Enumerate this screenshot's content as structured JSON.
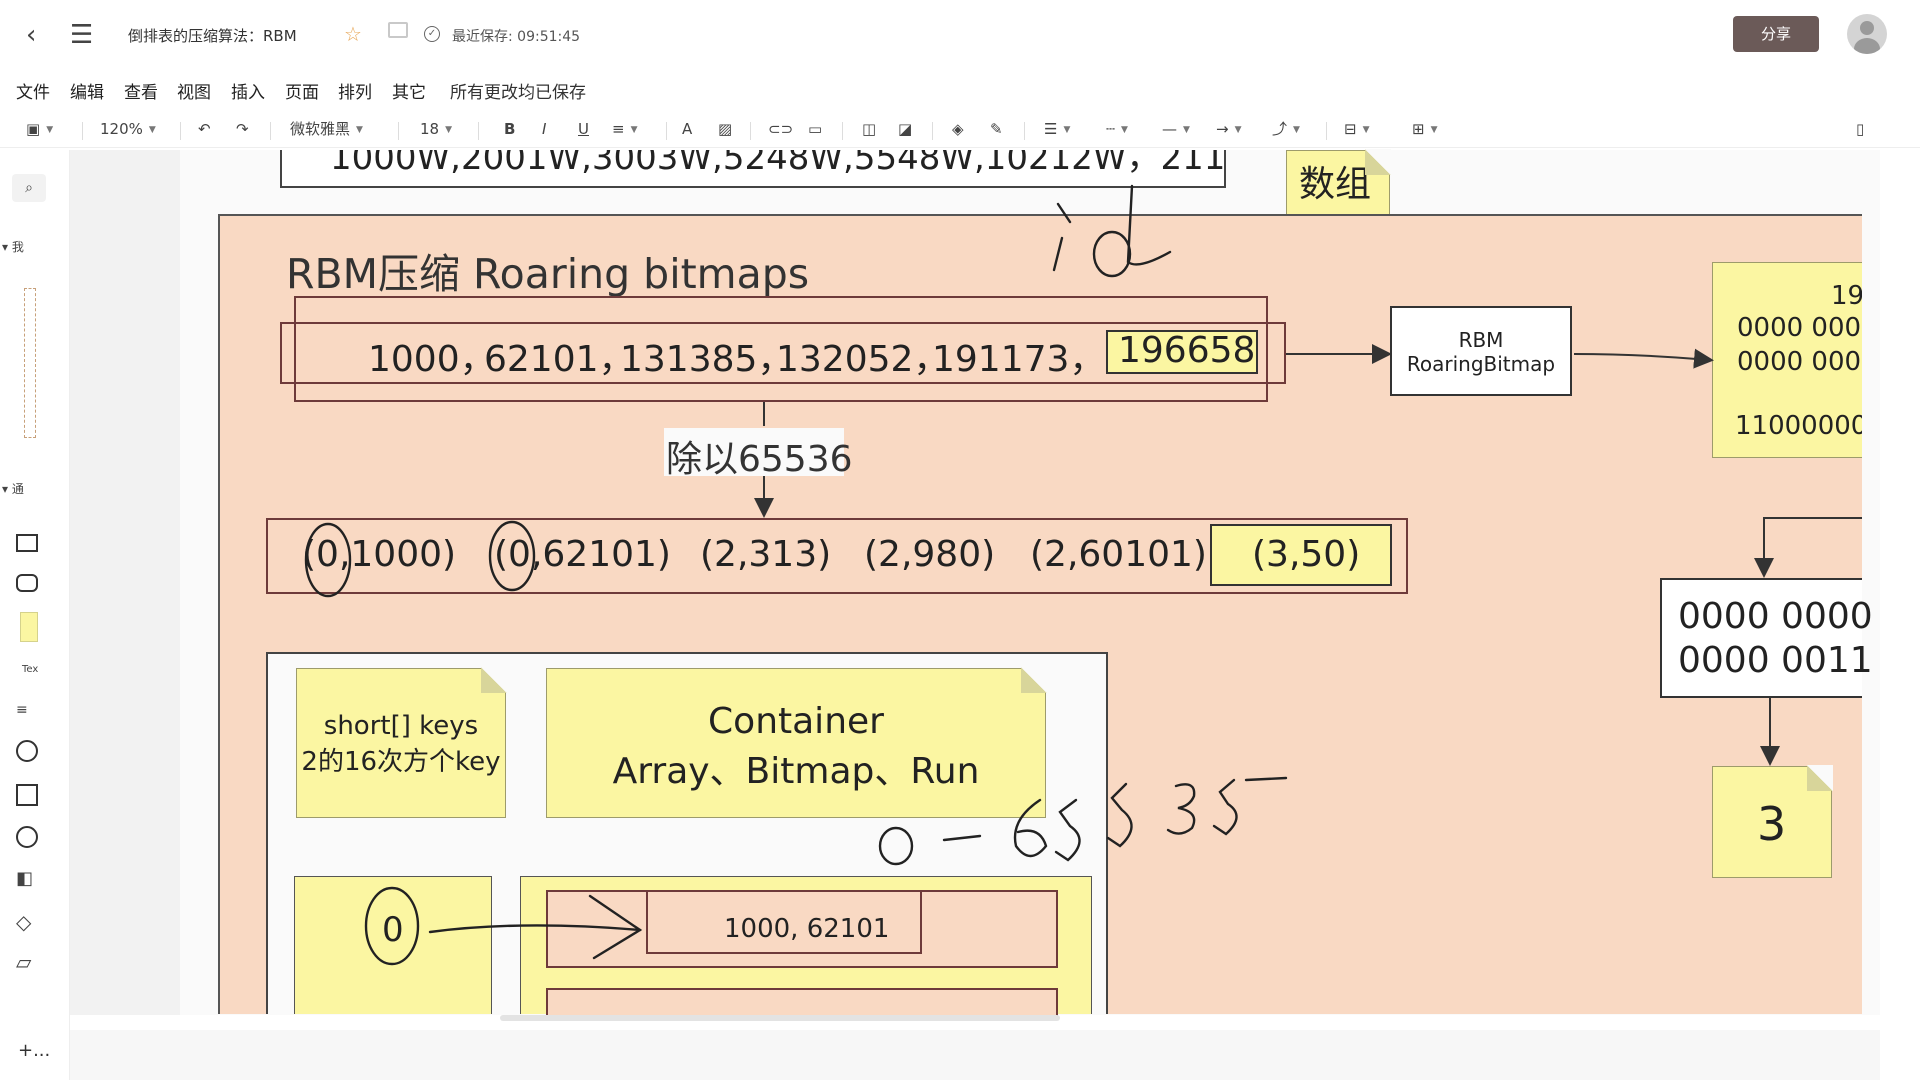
{
  "titlebar": {
    "doc_title": "倒排表的压缩算法：RBM",
    "save_time": "最近保存: 09:51:45",
    "share_label": "分享"
  },
  "menu": [
    "文件",
    "编辑",
    "查看",
    "视图",
    "插入",
    "页面",
    "排列",
    "其它",
    "所有更改均已保存"
  ],
  "toolbar": {
    "zoom": "120%",
    "font": "微软雅黑",
    "font_size": "18",
    "bold": "B",
    "italic": "I",
    "underline": "U",
    "font_color": "A"
  },
  "left_panel": {
    "section1": "我",
    "section2": "通",
    "text_tool": "Tex",
    "add_page": "+..."
  },
  "diagram": {
    "top_list": "1000W,2001W,3003W,5248W,5548W,10212W，211",
    "array_label": "数组",
    "title": "RBM压缩  Roaring bitmaps",
    "ids": [
      "1000，",
      "62101，",
      "131385，",
      "132052，",
      "191173，"
    ],
    "highlight_id": "196658",
    "rbm_box": [
      "RBM",
      "RoaringBitmap"
    ],
    "divide_label": "除以65536",
    "pairs": [
      "(0,1000)",
      "(0,62101)",
      "(2,313)",
      "(2,980)",
      "(2,60101)"
    ],
    "highlight_pair": "(3,50)",
    "keys_note": [
      "short[] keys",
      "2的16次方个key"
    ],
    "container_note": [
      "Container",
      "Array、Bitmap、Run"
    ],
    "key_zero": "0",
    "container_values": "1000, 62101",
    "bits_right_top": [
      "19",
      "0000 000",
      "0000 000",
      "11000000"
    ],
    "bits_box": [
      "0000 0000",
      "0000 0011"
    ],
    "result_note": "3",
    "handwriting_id": "id",
    "handwriting_range": "0 — 65535"
  },
  "colors": {
    "canvas_bg": "#f2f2f2",
    "frame_fill": "#f9d9c3",
    "note_fill": "#fbf6a2",
    "share_button": "#6b5a58",
    "star": "#e8a85a"
  }
}
